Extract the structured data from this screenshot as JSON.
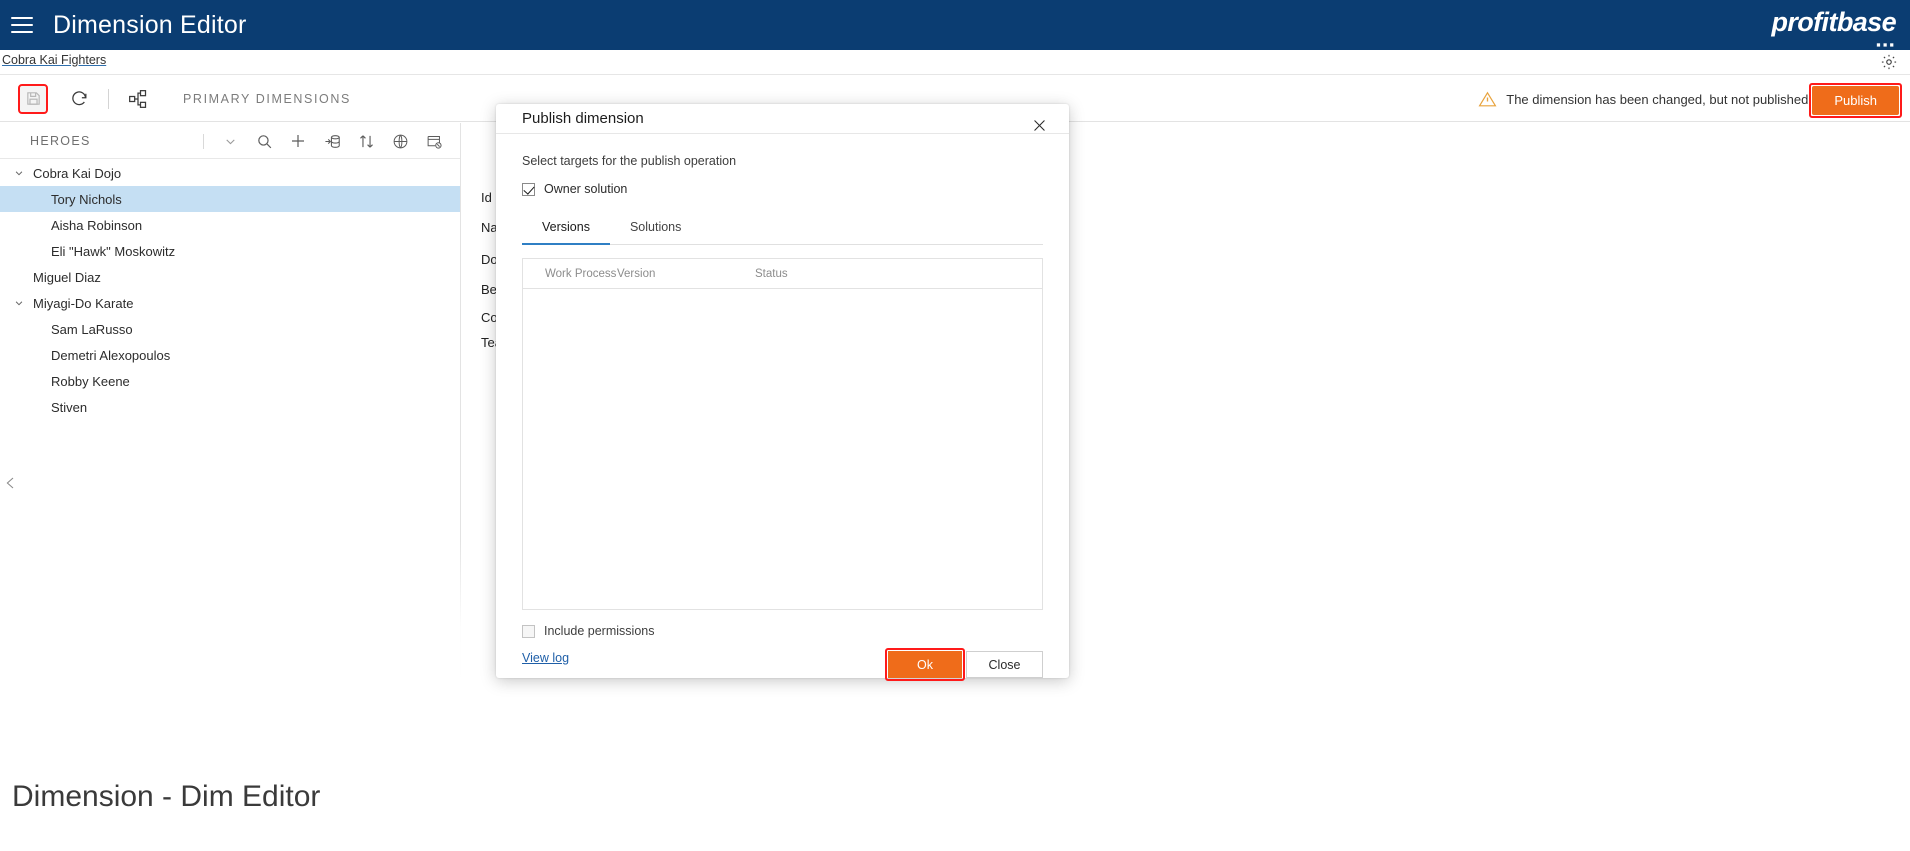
{
  "app": {
    "title": "Dimension Editor",
    "logo_text": "profitbase",
    "menu_icon": "hamburger-icon",
    "gear_icon": "gear-icon"
  },
  "breadcrumb": {
    "text": "Cobra Kai Fighters"
  },
  "toolbar": {
    "save_icon": "save-floppy-icon",
    "refresh_icon": "refresh-icon",
    "hierarchy_icon": "hierarchy-icon",
    "section_label": "PRIMARY DIMENSIONS",
    "warning_icon": "warning-triangle-icon",
    "warning_text": "The dimension has been changed, but not published.",
    "publish_label": "Publish",
    "publish_color": "#ef6c1a",
    "highlight_color": "#ff1a1a"
  },
  "left_panel": {
    "title": "HEROES",
    "icons": [
      {
        "name": "chevron-down-icon"
      },
      {
        "name": "search-icon"
      },
      {
        "name": "add-plus-icon"
      },
      {
        "name": "import-database-icon"
      },
      {
        "name": "sort-icon"
      },
      {
        "name": "globe-icon"
      },
      {
        "name": "remove-window-icon"
      }
    ],
    "collapse_icon": "collapse-left-chevron-icon",
    "tree": [
      {
        "label": "Cobra Kai Dojo",
        "level": 0,
        "expanded": true,
        "selected": false
      },
      {
        "label": "Tory Nichols",
        "level": 1,
        "expanded": null,
        "selected": true
      },
      {
        "label": "Aisha Robinson",
        "level": 1,
        "expanded": null,
        "selected": false
      },
      {
        "label": "Eli \"Hawk\" Moskowitz",
        "level": 1,
        "expanded": null,
        "selected": false
      },
      {
        "label": "Miguel Diaz",
        "level": 0,
        "expanded": null,
        "selected": false
      },
      {
        "label": "Miyagi-Do Karate",
        "level": 0,
        "expanded": true,
        "selected": false
      },
      {
        "label": "Sam LaRusso",
        "level": 1,
        "expanded": null,
        "selected": false
      },
      {
        "label": "Demetri Alexopoulos",
        "level": 1,
        "expanded": null,
        "selected": false
      },
      {
        "label": "Robby Keene",
        "level": 1,
        "expanded": null,
        "selected": false
      },
      {
        "label": "Stiven",
        "level": 1,
        "expanded": null,
        "selected": false
      }
    ]
  },
  "detail_pane": {
    "fields": [
      {
        "label": "Id"
      },
      {
        "label": "Na"
      },
      {
        "label": "Do"
      },
      {
        "label": "Bel"
      },
      {
        "label": "Co"
      },
      {
        "label": "Tea"
      }
    ]
  },
  "dialog": {
    "title": "Publish dimension",
    "close_icon": "close-x-icon",
    "instruction": "Select targets for the publish operation",
    "owner_solution": {
      "label": "Owner solution",
      "checked": true
    },
    "tabs": [
      {
        "label": "Versions",
        "active": true
      },
      {
        "label": "Solutions",
        "active": false
      }
    ],
    "grid": {
      "columns": [
        "Work Process",
        "Version",
        "Status"
      ],
      "rows": []
    },
    "include_permissions": {
      "label": "Include permissions",
      "checked": false
    },
    "view_log_label": "View log",
    "ok_label": "Ok",
    "close_label": "Close"
  },
  "bottom_overlay": {
    "title": "Dimension - Dim Editor"
  }
}
